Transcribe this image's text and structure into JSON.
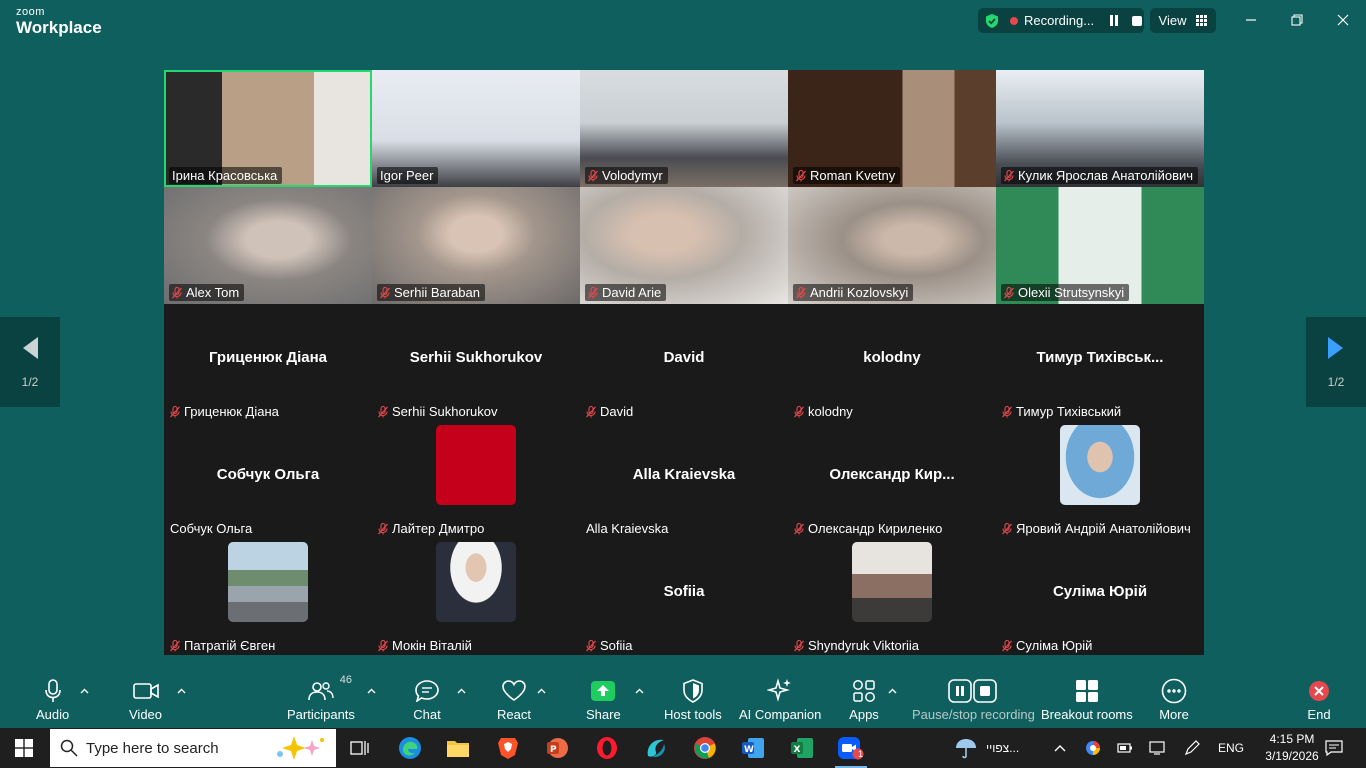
{
  "app": {
    "logo_small": "zoom",
    "logo_big": "Workplace"
  },
  "recording": {
    "status": "Recording..."
  },
  "view": {
    "label": "View"
  },
  "pager": {
    "left": "1/2",
    "right": "1/2"
  },
  "tiles": [
    {
      "name": "Ірина Красовська",
      "type": "video",
      "muted": false
    },
    {
      "name": "Igor Peer",
      "type": "video",
      "muted": false
    },
    {
      "name": "Volodymyr",
      "type": "video",
      "muted": true
    },
    {
      "name": "Roman Kvetny",
      "type": "video",
      "muted": true
    },
    {
      "name": "Кулик Ярослав Анатолійович",
      "type": "video",
      "muted": true
    },
    {
      "name": "Alex Tom",
      "type": "video",
      "muted": true
    },
    {
      "name": "Serhii Baraban",
      "type": "video",
      "muted": true
    },
    {
      "name": "David Arie",
      "type": "video",
      "muted": true
    },
    {
      "name": "Andrii Kozlovskyi",
      "type": "video",
      "muted": true
    },
    {
      "name": "Olexii Strutsynskyi",
      "type": "video",
      "muted": true
    },
    {
      "name": "Гриценюк Діана",
      "center": "Гриценюк Діана",
      "type": "blank",
      "muted": true
    },
    {
      "name": "Serhii Sukhorukov",
      "center": "Serhii Sukhorukov",
      "type": "blank",
      "muted": true
    },
    {
      "name": "David",
      "center": "David",
      "type": "blank",
      "muted": true
    },
    {
      "name": "kolodny",
      "center": "kolodny",
      "type": "blank",
      "muted": true
    },
    {
      "name": "Тимур Тихівський",
      "center": "Тимур Тихівськ...",
      "type": "blank",
      "muted": true
    },
    {
      "name": "Собчук Ольга",
      "center": "Собчук Ольга",
      "type": "blank",
      "muted": false
    },
    {
      "name": "Лайтер Дмитро",
      "type": "avatar",
      "avatar": "red",
      "muted": true
    },
    {
      "name": "Alla Kraievska",
      "center": "Alla Kraievska",
      "type": "blank",
      "muted": false
    },
    {
      "name": "Олександр Кириленко",
      "center": "Олександр Кир...",
      "type": "blank",
      "muted": true
    },
    {
      "name": "Яровий Андрій Анатолійович",
      "type": "avatar",
      "avatar": "portrait-blue",
      "muted": true
    },
    {
      "name": "Патратій Євген",
      "type": "avatar",
      "avatar": "car-photo",
      "muted": true
    },
    {
      "name": "Мокін Віталій",
      "type": "avatar",
      "avatar": "portrait-suit",
      "muted": true
    },
    {
      "name": "Sofiia",
      "center": "Sofiia",
      "type": "blank",
      "muted": true
    },
    {
      "name": "Shyndyruk Viktoriia",
      "type": "avatar",
      "avatar": "group-photo",
      "muted": true
    },
    {
      "name": "Суліма Юрій",
      "center": "Суліма Юрій",
      "type": "blank",
      "muted": true
    }
  ],
  "toolbar": {
    "audio": "Audio",
    "video": "Video",
    "participants": "Participants",
    "participants_count": "46",
    "chat": "Chat",
    "react": "React",
    "share": "Share",
    "host_tools": "Host tools",
    "ai_companion": "AI Companion",
    "apps": "Apps",
    "pause_recording": "Pause/stop recording",
    "breakout_rooms": "Breakout rooms",
    "more": "More",
    "end": "End"
  },
  "taskbar": {
    "search_placeholder": "Type here to search",
    "weather_text": "צפויי...",
    "language": "ENG",
    "time": "4:15 PM",
    "date": "3/19/2026",
    "zoom_badge": "1"
  },
  "colors": {
    "accent_green": "#23d96e",
    "share_green": "#1fcc5f",
    "end_red": "#e5484d",
    "bg_teal": "#0f5f5f"
  }
}
